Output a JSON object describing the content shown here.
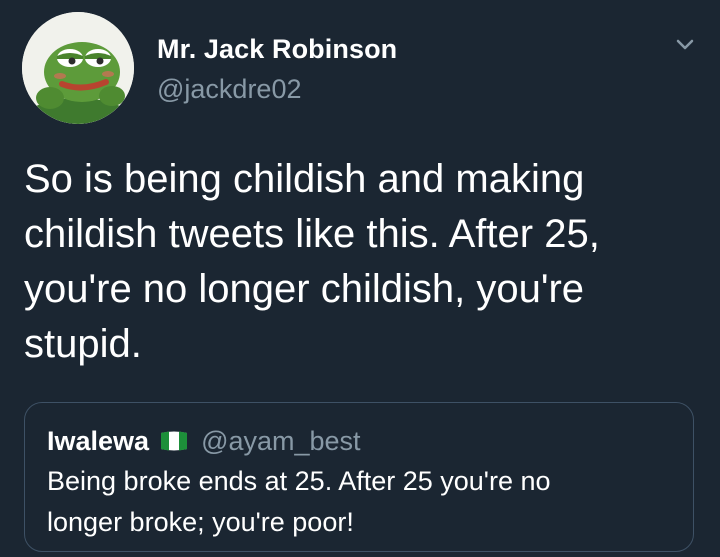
{
  "tweet": {
    "author": {
      "display_name": "Mr. Jack Robinson",
      "handle": "@jackdre02",
      "avatar_icon": "frog-avatar-icon"
    },
    "menu_icon": "chevron-down-icon",
    "text": "So is being childish and making\nchildish tweets like this. After 25,\nyou're no longer childish, you're\nstupid.",
    "quoted_tweet": {
      "display_name": "Iwalewa",
      "flag_icon": "nigeria-flag-icon",
      "handle": "@ayam_best",
      "text": "Being broke ends at 25. After 25 you're no\nlonger broke; you're poor!"
    }
  },
  "colors": {
    "background": "#1b2632",
    "text_primary": "#ffffff",
    "text_secondary": "#8899a6",
    "quote_border": "#3e5165",
    "flag_green": "#1d8f3a"
  }
}
